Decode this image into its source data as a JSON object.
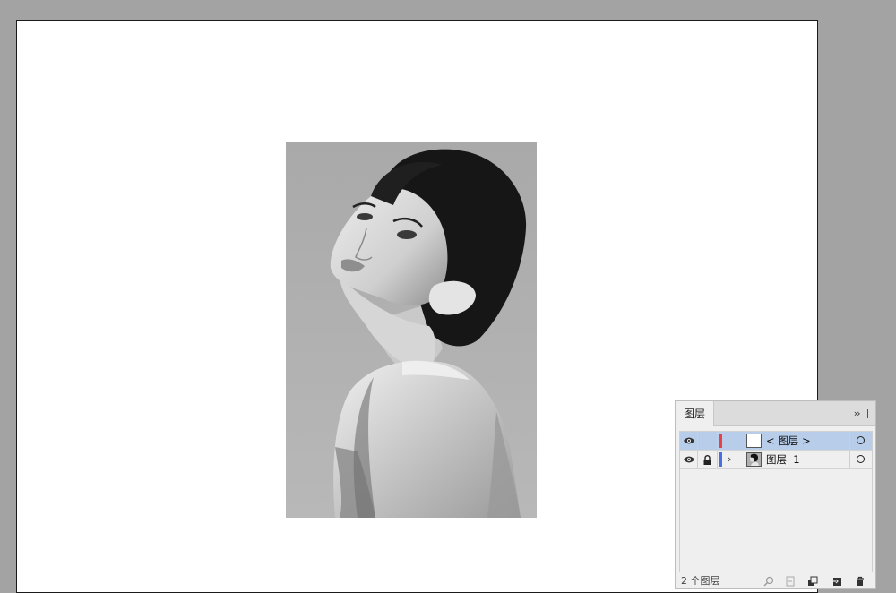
{
  "canvas": {
    "background": "#a3a3a3",
    "artboard_color": "#ffffff"
  },
  "photo": {
    "description_icon": "portrait-image",
    "tone": "grayscale"
  },
  "layers_panel": {
    "tab_label": "图层",
    "menu_icon": "double-chevron-right-icon",
    "layers": [
      {
        "name": "< 图层 >",
        "selected": true,
        "visible": true,
        "locked": false,
        "color": "#e8414a",
        "expandable": false,
        "thumb": "empty"
      },
      {
        "name": "图层  1",
        "selected": false,
        "visible": true,
        "locked": true,
        "color": "#4a6fe0",
        "expandable": true,
        "thumb": "portrait"
      }
    ],
    "footer": {
      "count_text": "2 个图层",
      "icons": [
        "search-icon",
        "export-icon",
        "make-clipping-mask-icon",
        "new-sublayer-icon",
        "new-layer-icon",
        "delete-icon"
      ]
    },
    "selection_color": "#b7cdea"
  }
}
